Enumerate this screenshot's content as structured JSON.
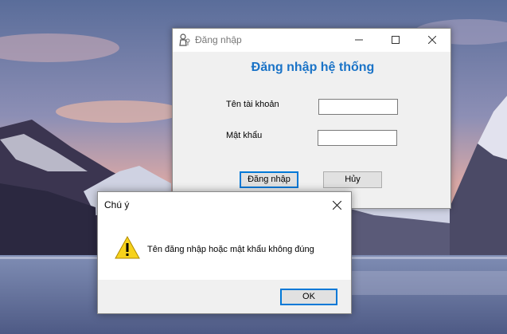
{
  "login_window": {
    "title": "Đăng nhập",
    "heading": "Đăng nhập hệ thống",
    "username_label": "Tên tài khoản",
    "username_value": "",
    "password_label": "Mật khẩu",
    "password_value": "",
    "login_button": "Đăng nhập",
    "cancel_button": "Hủy",
    "heading_color": "#1a73c7"
  },
  "message_box": {
    "title": "Chú ý",
    "message": "Tên đăng nhập hoặc mật khẩu không đúng",
    "ok_button": "OK",
    "icon": "warning-icon"
  },
  "icons": {
    "app_icon": "user-key-icon",
    "minimize": "minimize-icon",
    "maximize": "maximize-icon",
    "close": "close-icon"
  }
}
